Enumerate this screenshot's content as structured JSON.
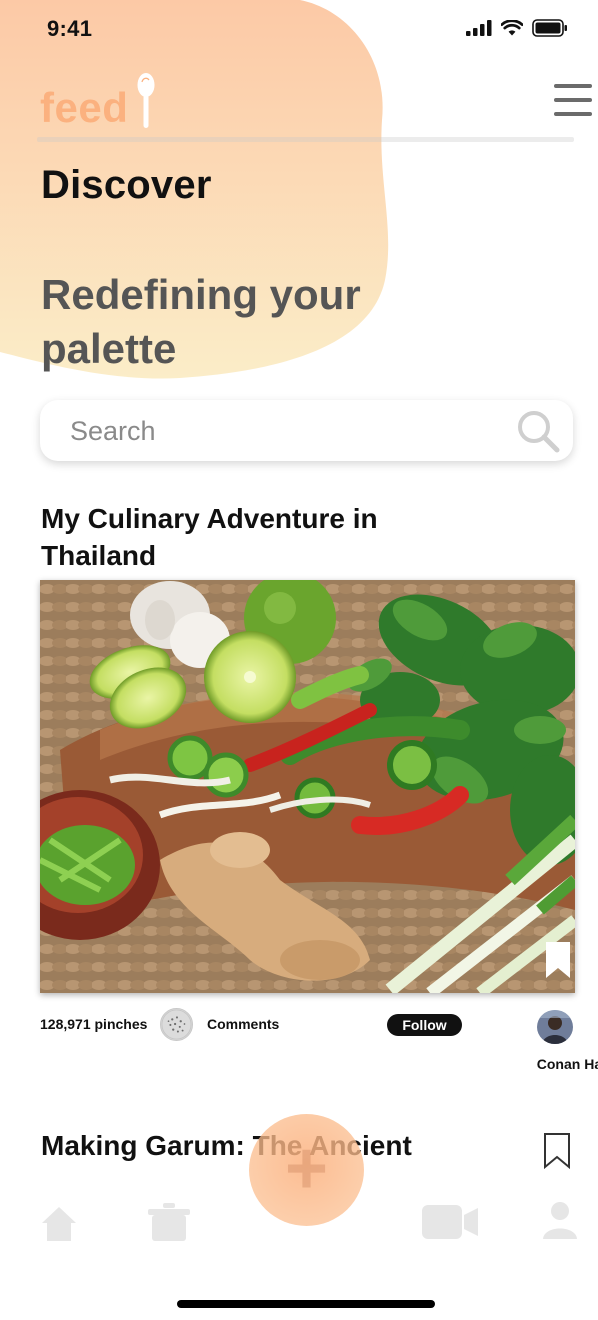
{
  "status_bar": {
    "time": "9:41"
  },
  "header": {
    "logo_text": "feed",
    "menu_icon": "hamburger-menu-icon"
  },
  "discover": {
    "heading": "Discover",
    "tagline": "Redefining your palette"
  },
  "search": {
    "placeholder": "Search",
    "icon": "search-icon"
  },
  "posts": [
    {
      "title": "My Culinary Adventure in Thailand",
      "pinches": "128,971 pinches",
      "comments_label": "Comments",
      "follow_label": "Follow",
      "author": "Conan Harr"
    },
    {
      "title": "Making Garum: The Ancient"
    }
  ],
  "tab_bar": {
    "items": [
      "home-icon",
      "pot-icon",
      "add-icon",
      "video-camera-icon",
      "profile-icon"
    ]
  },
  "colors": {
    "accent": "#fbb17f",
    "blob_top": "#fcc9a6",
    "blob_bottom": "#fbedc8"
  }
}
